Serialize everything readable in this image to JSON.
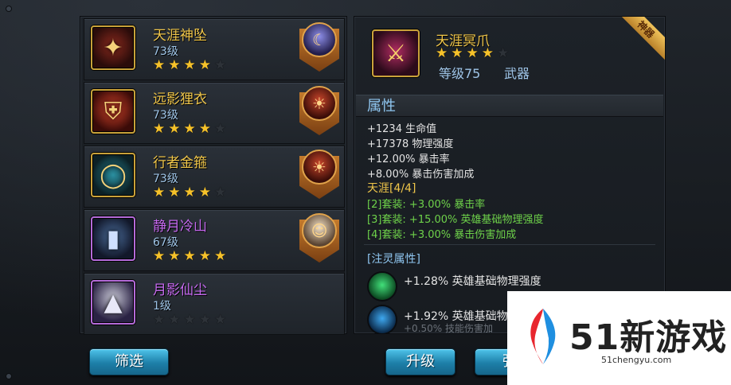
{
  "equipment_list": [
    {
      "name": "天涯神坠",
      "level": "73级",
      "stars": 4,
      "name_color": "gold",
      "icon": "pendant-icon",
      "hero_icon": "hero-portrait-icon"
    },
    {
      "name": "远影狸衣",
      "level": "73级",
      "stars": 4,
      "name_color": "gold",
      "icon": "armor-icon",
      "hero_icon": "hero-portrait-icon"
    },
    {
      "name": "行者金箍",
      "level": "73级",
      "stars": 4,
      "name_color": "gold",
      "icon": "headband-icon",
      "hero_icon": "hero-portrait-icon"
    },
    {
      "name": "静月冷山",
      "level": "67级",
      "stars": 5,
      "name_color": "purple",
      "icon": "boots-icon",
      "hero_icon": "hero-portrait-icon"
    },
    {
      "name": "月影仙尘",
      "level": "1级",
      "stars": 0,
      "name_color": "purple",
      "icon": "cloak-icon",
      "hero_icon": null
    }
  ],
  "buttons": {
    "filter": "筛选",
    "upgrade": "升级",
    "enhance": "强"
  },
  "detail": {
    "badge": "神器",
    "name": "天涯冥爪",
    "stars": 4,
    "max_stars": 5,
    "level": "等级75",
    "type": "武器",
    "section_attributes": "属性",
    "attributes": [
      "+1234 生命值",
      "+17378 物理强度",
      "+12.00% 暴击率",
      "+8.00% 暴击伤害加成"
    ],
    "set_title": "天涯[4/4]",
    "set_bonuses": [
      "[2]套装: +3.00% 暴击率",
      "[3]套装: +15.00% 英雄基础物理强度",
      "[4]套装: +3.00% 暴击伤害加成"
    ],
    "spirit_title": "[注灵属性]",
    "spirit_lines": [
      {
        "text": "+1.28% 英雄基础物理强度",
        "orb": "green-orb-icon"
      },
      {
        "text": "+1.92% 英雄基础物",
        "sub": "+0.50% 技能伤害加",
        "orb": "blue-orb-icon"
      }
    ]
  },
  "watermark": {
    "brand": "51新游戏",
    "url": "51chengyu.com"
  },
  "colors": {
    "gold_text": "#f0c64a",
    "purple_text": "#c66af0",
    "blue_text": "#9fc5e8",
    "set_green": "#6ed24a",
    "button_blue": "#1d7fa8"
  }
}
